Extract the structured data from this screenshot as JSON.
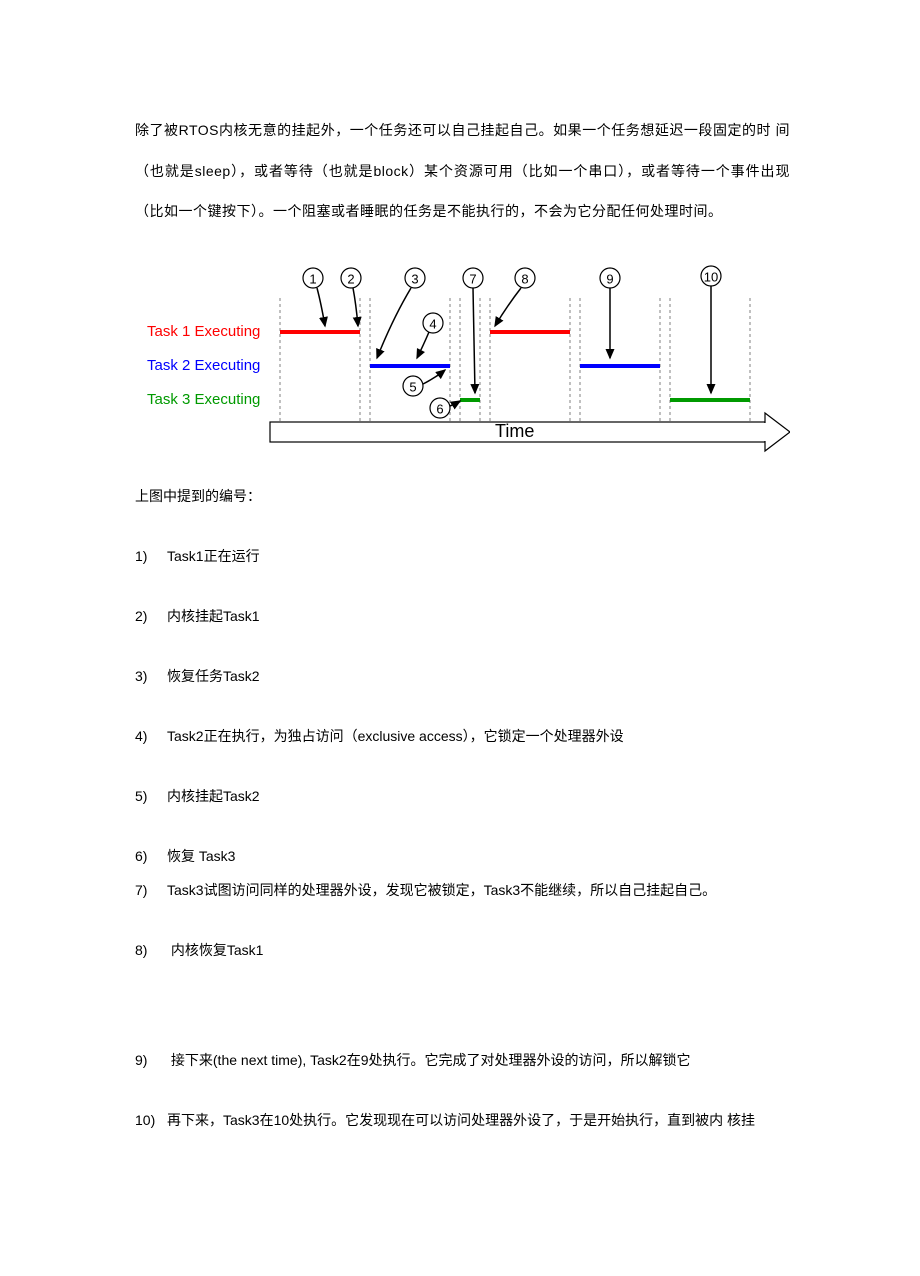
{
  "intro": "除了被RTOS内核无意的挂起外，一个任务还可以自己挂起自己。如果一个任务想延迟一段固定的时 间（也就是sleep），或者等待（也就是block）某个资源可用（比如一个串口），或者等待一个事件出现（比如一个键按下）。一个阻塞或者睡眠的任务是不能执行的，不会为它分配任何处理时间。",
  "caption": "上图中提到的编号：",
  "diagram": {
    "labels": {
      "task1": "Task 1 Executing",
      "task2": "Task 2 Executing",
      "task3": "Task 3 Executing",
      "time": "Time"
    },
    "markers": [
      "1",
      "2",
      "3",
      "4",
      "5",
      "6",
      "7",
      "8",
      "9",
      "10"
    ]
  },
  "items": [
    {
      "num": "1)",
      "text": "Task1正在运行"
    },
    {
      "num": "2)",
      "text": "内核挂起Task1"
    },
    {
      "num": "3)",
      "text": "恢复任务Task2"
    },
    {
      "num": "4)",
      "text": "Task2正在执行，为独占访问（exclusive access），它锁定一个处理器外设"
    },
    {
      "num": "5)",
      "text": "内核挂起Task2"
    },
    {
      "num": "6)",
      "text": "恢复 Task3",
      "tight": true
    },
    {
      "num": "7)",
      "text": "Task3试图访问同样的处理器外设，发现它被锁定，Task3不能继续，所以自己挂起自己。",
      "tight": true
    },
    {
      "num": "8)",
      "text": " 内核恢复Task1"
    },
    {
      "num": "9)",
      "text": " 接下来(the next time), Task2在9处执行。它完成了对处理器外设的访问，所以解锁它",
      "gap": true
    },
    {
      "num": "10)",
      "text": "再下来，Task3在10处执行。它发现现在可以访问处理器外设了，于是开始执行，直到被内 核挂"
    }
  ]
}
